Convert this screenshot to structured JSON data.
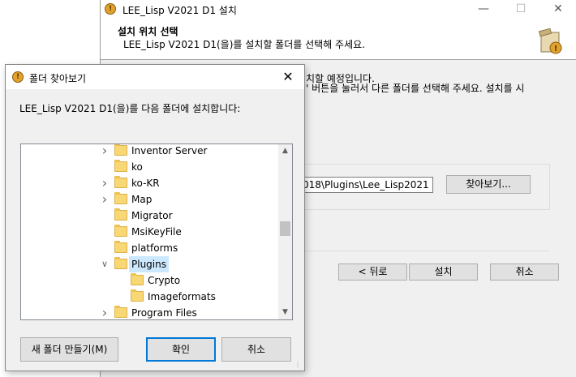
{
  "installer": {
    "title": "LEE_Lisp V2021 D1 설치",
    "header_title": "설치 위치 선택",
    "header_subtitle": "LEE_Lisp V2021 D1(을)를 설치할 폴더를 선택해 주세요.",
    "body_line1": "치할 예정입니다.",
    "body_line2": "' 버튼을 눌러서 다른 폴더를 선택해 주세요. 설치를 시",
    "path_value": "018\\Plugins\\Lee_Lisp2021",
    "browse_label": "찾아보기...",
    "back_label": "< 뒤로",
    "install_label": "설치",
    "cancel_label": "취소"
  },
  "dialog": {
    "title": "폴더 찾아보기",
    "description": "LEE_Lisp V2021 D1(을)를 다음 폴더에 설치합니다:",
    "tree": [
      {
        "label": "Inventor Server",
        "expander": "collapsed"
      },
      {
        "label": "ko",
        "expander": "none"
      },
      {
        "label": "ko-KR",
        "expander": "collapsed"
      },
      {
        "label": "Map",
        "expander": "collapsed"
      },
      {
        "label": "Migrator",
        "expander": "none"
      },
      {
        "label": "MsiKeyFile",
        "expander": "none"
      },
      {
        "label": "platforms",
        "expander": "none"
      },
      {
        "label": "Plugins",
        "expander": "expanded",
        "selected": true
      },
      {
        "label": "Crypto",
        "expander": "none"
      },
      {
        "label": "Imageformats",
        "expander": "none"
      },
      {
        "label": "Program Files",
        "expander": "collapsed"
      }
    ],
    "new_folder_label": "새 폴더 만들기(M)",
    "ok_label": "확인",
    "cancel_label": "취소"
  }
}
